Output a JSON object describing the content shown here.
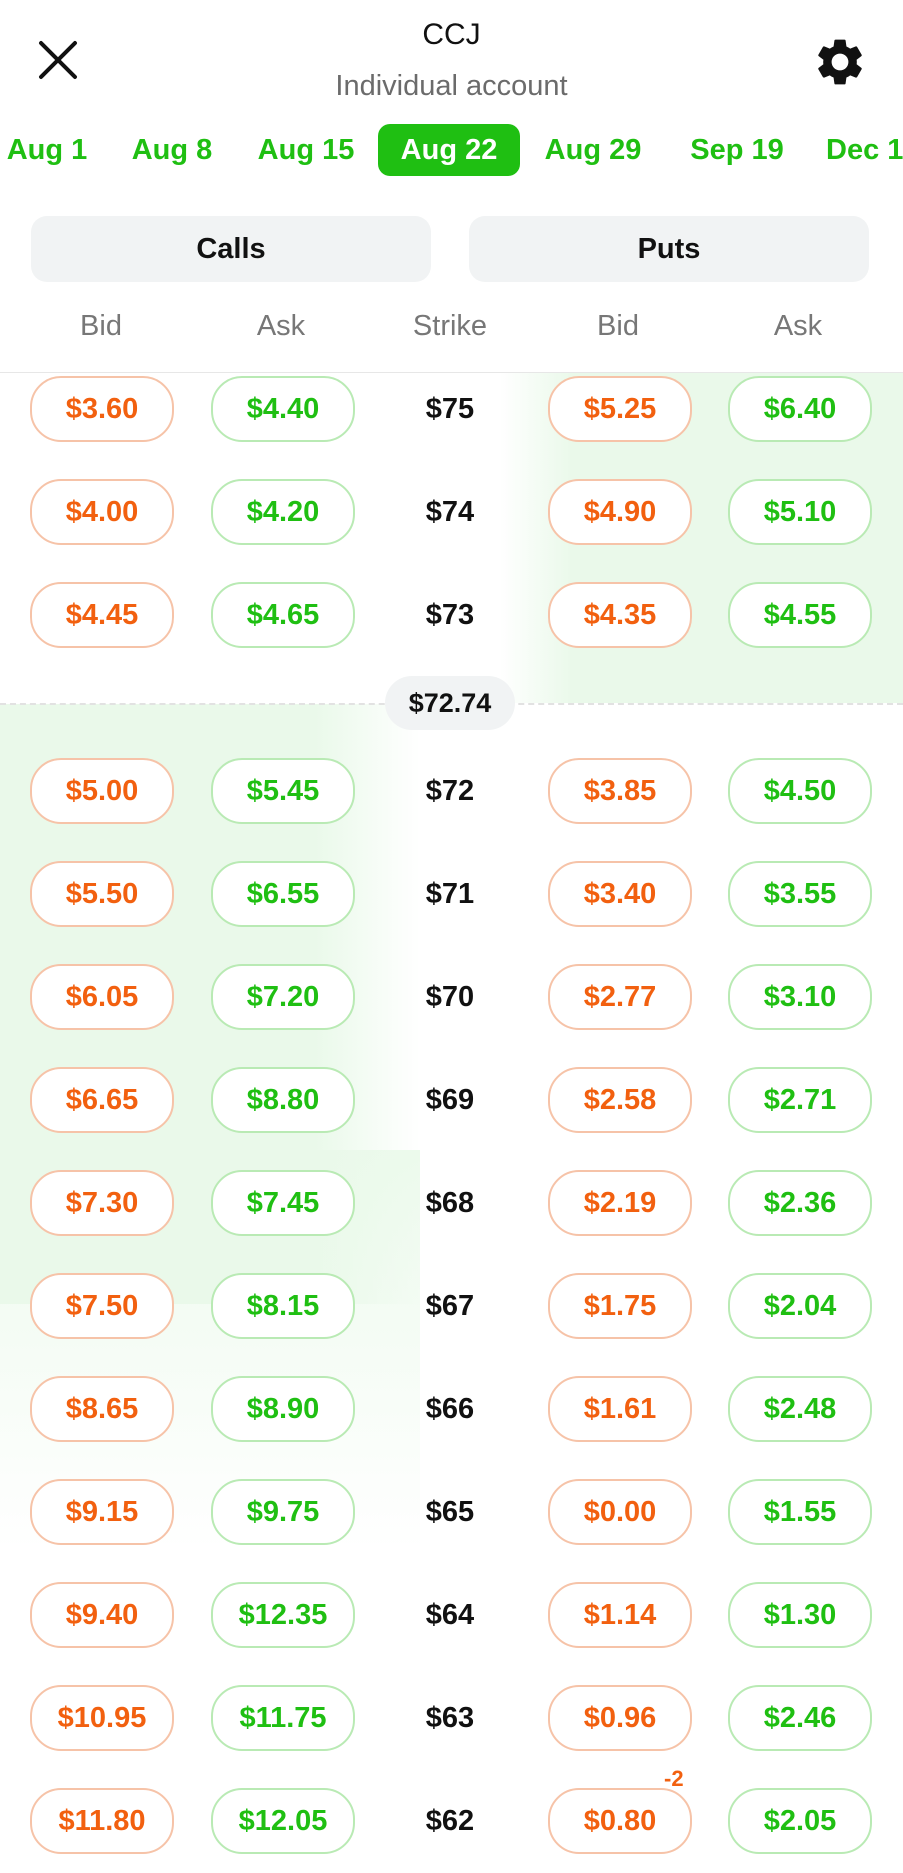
{
  "header": {
    "ticker": "CCJ",
    "account": "Individual account"
  },
  "expirations": [
    {
      "label": "Aug 1",
      "active": false
    },
    {
      "label": "Aug 8",
      "active": false
    },
    {
      "label": "Aug 15",
      "active": false
    },
    {
      "label": "Aug 22",
      "active": true
    },
    {
      "label": "Aug 29",
      "active": false
    },
    {
      "label": "Sep 19",
      "active": false
    },
    {
      "label": "Dec 1",
      "active": false
    }
  ],
  "segments": {
    "calls": "Calls",
    "puts": "Puts"
  },
  "columns": {
    "call_bid": "Bid",
    "call_ask": "Ask",
    "strike": "Strike",
    "put_bid": "Bid",
    "put_ask": "Ask"
  },
  "current_price": "$72.74",
  "rows": [
    {
      "call_bid": "$3.60",
      "call_ask": "$4.40",
      "strike": "$75",
      "put_bid": "$5.25",
      "put_ask": "$6.40"
    },
    {
      "call_bid": "$4.00",
      "call_ask": "$4.20",
      "strike": "$74",
      "put_bid": "$4.90",
      "put_ask": "$5.10"
    },
    {
      "call_bid": "$4.45",
      "call_ask": "$4.65",
      "strike": "$73",
      "put_bid": "$4.35",
      "put_ask": "$4.55"
    },
    {
      "call_bid": "$5.00",
      "call_ask": "$5.45",
      "strike": "$72",
      "put_bid": "$3.85",
      "put_ask": "$4.50"
    },
    {
      "call_bid": "$5.50",
      "call_ask": "$6.55",
      "strike": "$71",
      "put_bid": "$3.40",
      "put_ask": "$3.55"
    },
    {
      "call_bid": "$6.05",
      "call_ask": "$7.20",
      "strike": "$70",
      "put_bid": "$2.77",
      "put_ask": "$3.10"
    },
    {
      "call_bid": "$6.65",
      "call_ask": "$8.80",
      "strike": "$69",
      "put_bid": "$2.58",
      "put_ask": "$2.71"
    },
    {
      "call_bid": "$7.30",
      "call_ask": "$7.45",
      "strike": "$68",
      "put_bid": "$2.19",
      "put_ask": "$2.36"
    },
    {
      "call_bid": "$7.50",
      "call_ask": "$8.15",
      "strike": "$67",
      "put_bid": "$1.75",
      "put_ask": "$2.04"
    },
    {
      "call_bid": "$8.65",
      "call_ask": "$8.90",
      "strike": "$66",
      "put_bid": "$1.61",
      "put_ask": "$2.48"
    },
    {
      "call_bid": "$9.15",
      "call_ask": "$9.75",
      "strike": "$65",
      "put_bid": "$0.00",
      "put_ask": "$1.55"
    },
    {
      "call_bid": "$9.40",
      "call_ask": "$12.35",
      "strike": "$64",
      "put_bid": "$1.14",
      "put_ask": "$1.30"
    },
    {
      "call_bid": "$10.95",
      "call_ask": "$11.75",
      "strike": "$63",
      "put_bid": "$0.96",
      "put_ask": "$2.46"
    },
    {
      "call_bid": "$11.80",
      "call_ask": "$12.05",
      "strike": "$62",
      "put_bid": "$0.80",
      "put_ask": "$2.05",
      "put_bid_badge": "-2"
    }
  ],
  "colors": {
    "accent_green": "#1fbf12",
    "bid_orange": "#f2600f",
    "itm_shade": "#eaf9ea"
  },
  "icons": {
    "close": "close-icon",
    "settings": "gear-icon"
  }
}
